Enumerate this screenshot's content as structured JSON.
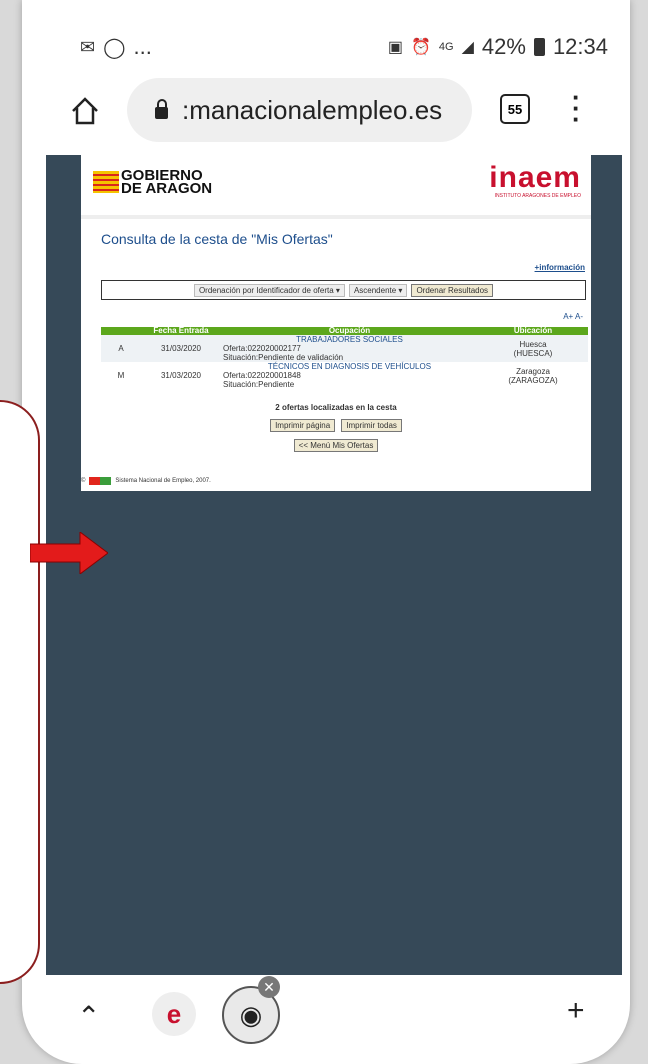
{
  "status_bar": {
    "left_icons": [
      "notification-icon",
      "whatsapp-icon"
    ],
    "ellipsis": "...",
    "network": "4G",
    "battery": "42%",
    "time": "12:34"
  },
  "browser": {
    "url": ":manacionalempleo.es",
    "tab_count": "55"
  },
  "page": {
    "gobierno_line1": "GOBIERNO",
    "gobierno_line2": "DE ARAGON",
    "inaem_logo": "inaem",
    "inaem_sub": "INSTITUTO ARAGONES DE EMPLEO",
    "title": "Consulta de la cesta de \"Mis Ofertas\"",
    "info_link": "+información",
    "filter": {
      "order_by": "Ordenación por Identificador de oferta",
      "direction": "Ascendente",
      "submit": "Ordenar Resultados"
    },
    "font_size_links": "A+ A-",
    "table": {
      "headers": [
        "",
        "Fecha Entrada",
        "Ocupación",
        "Ubicación"
      ],
      "rows": [
        {
          "col0": "A",
          "date": "31/03/2020",
          "occupation": "TRABAJADORES SOCIALES",
          "offer": "Oferta:022020002177",
          "situation": "Situación:Pendiente de validación",
          "location1": "Huesca",
          "location2": "(HUESCA)"
        },
        {
          "col0": "M",
          "date": "31/03/2020",
          "occupation": "TÉCNICOS EN DIAGNOSIS DE VEHÍCULOS",
          "offer": "Oferta:022020001848",
          "situation": "Situación:Pendiente",
          "location1": "Zaragoza",
          "location2": "(ZARAGOZA)"
        }
      ]
    },
    "found_text": "2 ofertas localizadas en la cesta",
    "print_page": "Imprimir página",
    "print_all": "Imprimir todas",
    "back_menu": "<< Menú Mis Ofertas",
    "footer": "Sistema Nacional de Empleo, 2007."
  },
  "colors": {
    "content_bg": "#364958",
    "table_header": "#5ca71c",
    "link": "#1d4e8c",
    "brand_red": "#c8102e",
    "arrow": "#e31b1b"
  }
}
